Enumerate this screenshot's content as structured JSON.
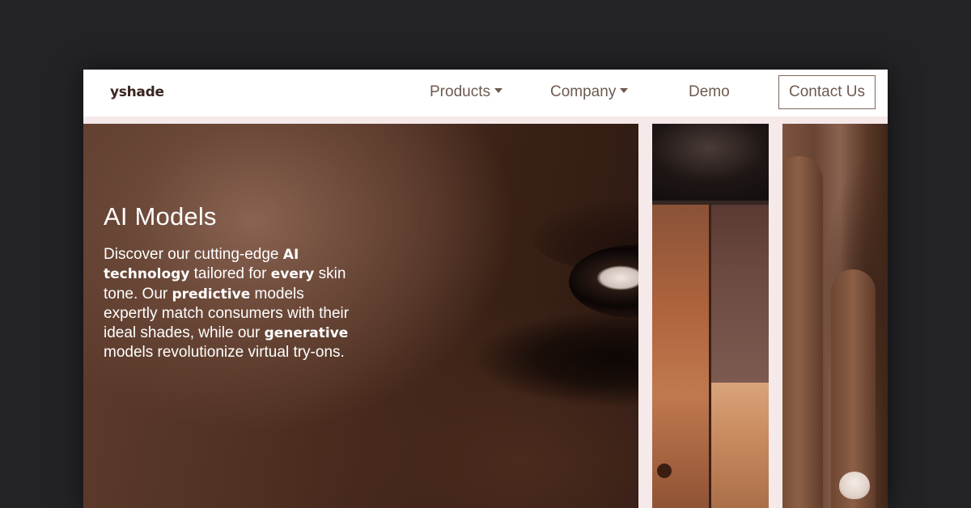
{
  "brand": {
    "logo_text": "yshade"
  },
  "nav": {
    "products": "Products",
    "company": "Company",
    "demo": "Demo",
    "contact": "Contact Us"
  },
  "hero": {
    "title": "AI Models",
    "description_parts": [
      {
        "text": "Discover our cutting-edge ",
        "bold": false
      },
      {
        "text": "AI technology",
        "bold": true
      },
      {
        "text": " tailored for ",
        "bold": false
      },
      {
        "text": "every",
        "bold": true
      },
      {
        "text": " skin tone. Our ",
        "bold": false
      },
      {
        "text": "predictive",
        "bold": true
      },
      {
        "text": " models expertly match consumers with their ideal shades, while our ",
        "bold": false
      },
      {
        "text": "generative",
        "bold": true
      },
      {
        "text": " models revolutionize virtual try-ons.",
        "bold": false
      }
    ]
  },
  "colors": {
    "page_background": "#232326",
    "nav_text": "#6d5a4f",
    "logo_text": "#3a2520",
    "panel_gap": "#f5e9ea",
    "hero_text": "#ffffff"
  },
  "icons": {
    "dropdown": "caret-down-icon"
  }
}
